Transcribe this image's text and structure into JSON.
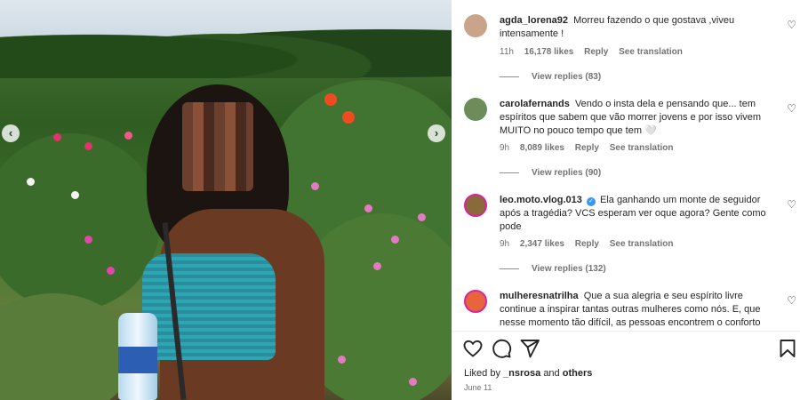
{
  "post": {
    "image_alt": "Photo of a woman in a teal crop top standing in a flower garden",
    "prev_icon": "chevron-left-icon",
    "next_icon": "chevron-right-icon"
  },
  "comments": [
    {
      "username": "agda_lorena92",
      "verified": false,
      "text": "Morreu fazendo o que gostava ,viveu intensamente !",
      "time": "11h",
      "likes": "16,178 likes",
      "reply_label": "Reply",
      "translate_label": "See translation",
      "view_replies": "View replies (83)",
      "avatar_color": "#c9a48a"
    },
    {
      "username": "carolafernands",
      "verified": false,
      "text": "Vendo o insta dela e pensando que... tem espíritos que sabem que vão morrer jovens e por isso vivem MUITO no pouco tempo que tem 🤍",
      "time": "9h",
      "likes": "8,089 likes",
      "reply_label": "Reply",
      "translate_label": "See translation",
      "view_replies": "View replies (90)",
      "avatar_color": "#6c8c5a"
    },
    {
      "username": "leo.moto.vlog.013",
      "verified": true,
      "text": "Ela ganhando um monte de seguidor após a tragédia? VCS esperam ver oque agora? Gente como pode",
      "time": "9h",
      "likes": "2,347 likes",
      "reply_label": "Reply",
      "translate_label": "See translation",
      "view_replies": "View replies (132)",
      "avatar_color": "#8a6a3a"
    },
    {
      "username": "mulheresnatrilha",
      "verified": false,
      "text": "Que a sua alegria e seu espírito livre continue a inspirar tantas outras mulheres como nós. E, que nesse momento tão difícil, as pessoas encontrem o conforto",
      "avatar_color": "#e8643c"
    }
  ],
  "actions": {
    "like_icon": "heart-icon",
    "comment_icon": "comment-icon",
    "share_icon": "share-icon",
    "save_icon": "bookmark-icon"
  },
  "liked_by": {
    "prefix": "Liked by",
    "user": "_nsrosa",
    "and": "and",
    "others": "others"
  },
  "date": "June 11"
}
